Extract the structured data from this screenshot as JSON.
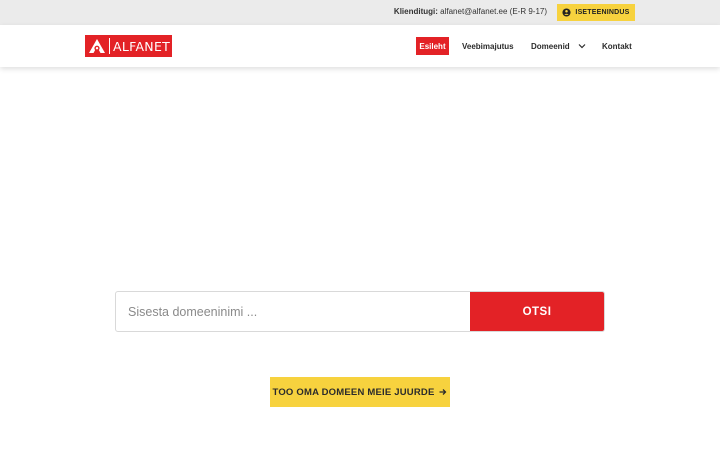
{
  "topbar": {
    "support_label": "Klienditugi:",
    "support_contact": "alfanet@alfanet.ee (E-R 9-17)",
    "self_service": "ISETEENINDUS"
  },
  "header": {
    "logo_text": "ALFANET",
    "nav": [
      {
        "label": "Esileht",
        "active": true
      },
      {
        "label": "Veebimajutus"
      },
      {
        "label": "Domeenid"
      },
      {
        "label": "Kontakt"
      }
    ]
  },
  "search": {
    "placeholder": "Sisesta domeeninimi ...",
    "button": "OTSI"
  },
  "transfer_button": "TOO OMA DOMEEN MEIE JUURDE",
  "colors": {
    "brand_red": "#e32226",
    "accent_yellow": "#f7d23e",
    "topbar_bg": "#ebebeb"
  }
}
